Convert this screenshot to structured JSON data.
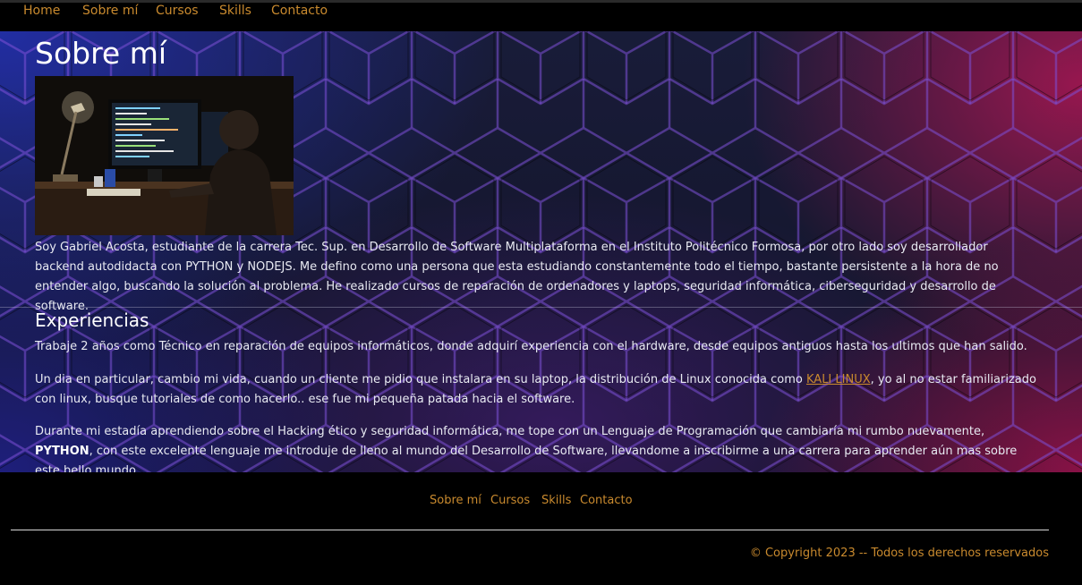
{
  "nav": {
    "items": [
      {
        "label": "Home"
      },
      {
        "label": "Sobre mí"
      },
      {
        "label": "Cursos"
      },
      {
        "label": "Skills"
      },
      {
        "label": "Contacto"
      }
    ]
  },
  "about": {
    "title": "Sobre mí",
    "photo_icon": "developer-at-computer-photo",
    "bio": "Soy Gabriel Acosta, estudiante de la carrera Tec. Sup. en Desarrollo de Software Multiplataforma en el Instituto Politécnico Formosa, por otro lado soy desarrollador backend autodidacta con PYTHON y NODEJS. Me defino como una persona que esta estudiando constantemente todo el tiempo, bastante persistente a la hora de no entender algo, buscando la solución al problema. He realizado cursos de reparación de ordenadores y laptops, seguridad informática, ciberseguridad y desarrollo de software."
  },
  "experience": {
    "title": "Experiencias",
    "p1": "Trabaje 2 años como Técnico en reparación de equipos informáticos, donde adquirí experiencia con el hardware, desde equipos antiguos hasta los ultimos que han salido.",
    "p2_before": "Un dia en particular, cambio mi vida, cuando un cliente me pidio que instalara en su laptop, la distribución de Linux conocida como ",
    "p2_link": "KALI LINUX",
    "p2_after": ", yo al no estar familiarizado con linux, busque tutoriales de como hacerlo.. ese fue mi pequeña patada hacia el software.",
    "p3_before": "Durante mi estadía aprendiendo sobre el Hacking ético y seguridad informática, me tope con un Lenguaje de Programación que cambiaría mi rumbo nuevamente, ",
    "p3_bold": "PYTHON",
    "p3_after": ", con este excelente lenguaje me introduje de lleno al mundo del Desarrollo de Software, llevandome a inscribirme a una carrera para aprender aún mas sobre este bello mundo."
  },
  "footer": {
    "items": [
      {
        "label": "Sobre mí"
      },
      {
        "label": "Cursos"
      },
      {
        "label": "Skills"
      },
      {
        "label": "Contacto"
      }
    ],
    "copyright": "© Copyright 2023 -- Todos los derechos reservados"
  },
  "colors": {
    "accent": "#c98a2e",
    "background": "#000000",
    "hero_blue": "#2837c8",
    "hero_pink": "#d2195f"
  }
}
